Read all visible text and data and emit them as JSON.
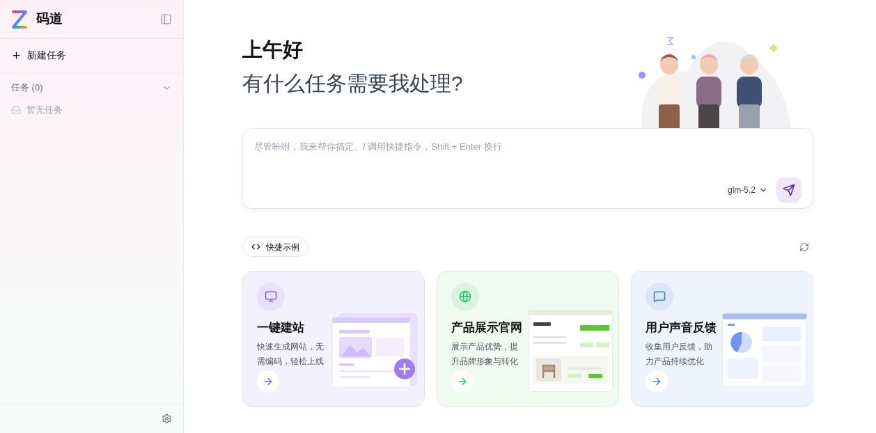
{
  "sidebar": {
    "app_name": "码道",
    "new_task": "新建任务",
    "tasks_header": {
      "label": "任务 (0)",
      "expanded": true
    },
    "empty_text": "暂无任务"
  },
  "greeting": {
    "title": "上午好",
    "subtitle": "有什么任务需要我处理?"
  },
  "prompt": {
    "placeholder": "尽管吩咐，我来帮你搞定。/ 调用快捷指令，Shift + Enter 换行",
    "model": "glm-5.2"
  },
  "examples_button": "快捷示例",
  "cards": [
    {
      "kind": "website",
      "title": "一键建站",
      "description": "快速生成网站，无需编码，轻松上线"
    },
    {
      "kind": "product",
      "title": "产品展示官网",
      "description": "展示产品优势，提升品牌形象与转化"
    },
    {
      "kind": "feedback",
      "title": "用户声音反馈",
      "description": "收集用户反馈，助力产品持续优化"
    }
  ]
}
